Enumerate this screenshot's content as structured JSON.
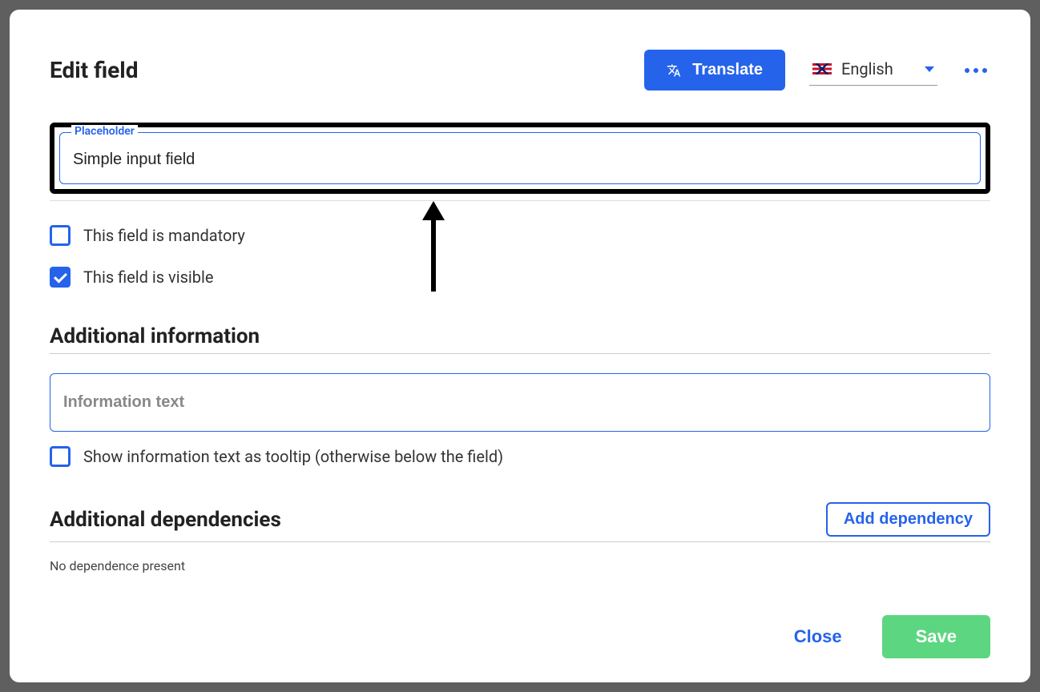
{
  "header": {
    "title": "Edit field",
    "translate_label": "Translate",
    "language": "English"
  },
  "placeholder_field": {
    "label": "Placeholder",
    "value": "Simple input field"
  },
  "checkboxes": {
    "mandatory": {
      "label": "This field is mandatory",
      "checked": false
    },
    "visible": {
      "label": "This field is visible",
      "checked": true
    },
    "tooltip": {
      "label": "Show information text as tooltip (otherwise below the field)",
      "checked": false
    }
  },
  "sections": {
    "additional_info": "Additional information",
    "info_placeholder": "Information text",
    "additional_deps": "Additional dependencies",
    "no_deps": "No dependence present",
    "add_dep_label": "Add dependency"
  },
  "footer": {
    "close": "Close",
    "save": "Save"
  }
}
